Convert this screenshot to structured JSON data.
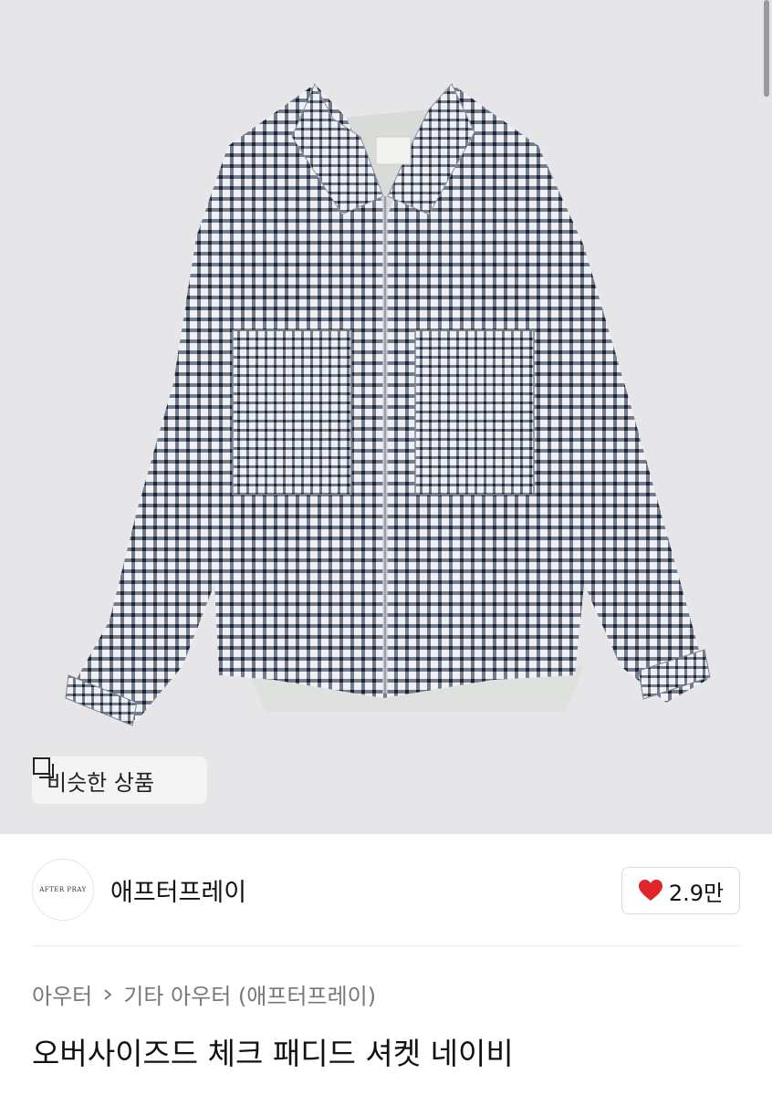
{
  "product_image": {
    "alt": "",
    "garment_label_brand": "AFTER PRAY",
    "background_color": "#e6e6e8"
  },
  "similar_button": {
    "label": "비슷한 상품",
    "icon": "similar-items-icon"
  },
  "brand": {
    "logo_text": "AFTER PRAY",
    "name": "애프터프레이"
  },
  "likes": {
    "count": "2.9만",
    "icon": "heart-icon",
    "color": "#e0262b"
  },
  "breadcrumb": {
    "category": "아우터",
    "separator_icon": "chevron-right-icon",
    "subcategory": "기타 아우터 (애프터프레이)"
  },
  "product": {
    "title": "오버사이즈드 체크 패디드 셔켓 네이비"
  }
}
